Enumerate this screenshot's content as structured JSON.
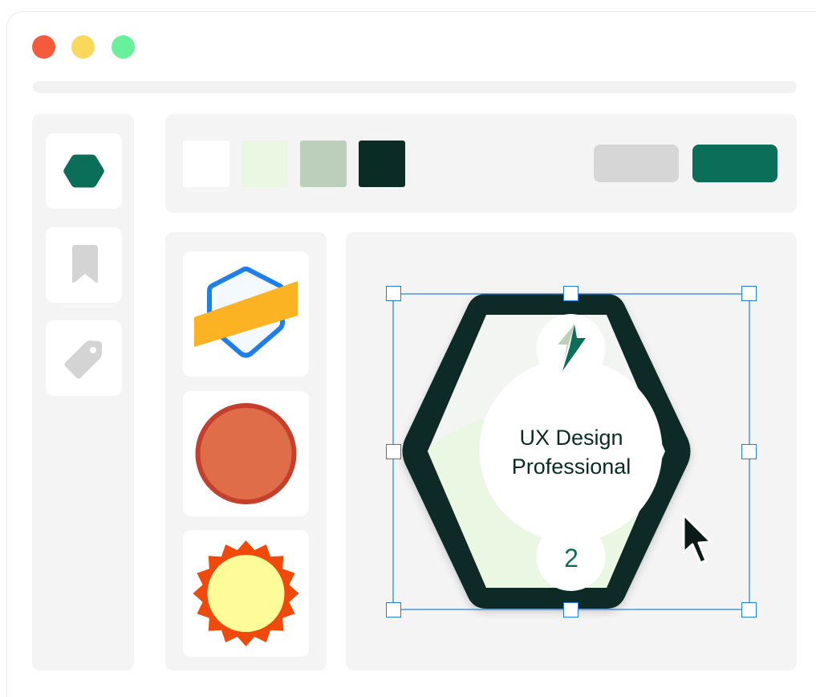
{
  "window_controls": [
    {
      "name": "close",
      "color": "#f45a3b"
    },
    {
      "name": "minimize",
      "color": "#f9d85c"
    },
    {
      "name": "maximize",
      "color": "#68f09a"
    }
  ],
  "sidebar": {
    "items": [
      {
        "icon": "hexagon-icon",
        "active": true,
        "color": "#0b6e58"
      },
      {
        "icon": "bookmark-icon",
        "active": false,
        "color": "#d4d4d4"
      },
      {
        "icon": "tag-icon",
        "active": false,
        "color": "#d4d4d4"
      }
    ]
  },
  "toolbar": {
    "swatches": [
      "#ffffff",
      "#e9f7e3",
      "#bccfba",
      "#0b2c25"
    ],
    "secondary_button": {
      "label": "",
      "color": "#d6d6d6"
    },
    "primary_button": {
      "label": "",
      "color": "#0b6e58"
    }
  },
  "shape_library": [
    {
      "icon": "shield-ribbon-badge-icon",
      "colors": {
        "outline": "#1f7fe8",
        "fill": "#f3f9ff",
        "ribbon": "#fbb324"
      }
    },
    {
      "icon": "circle-badge-icon",
      "colors": {
        "outline": "#c4402c",
        "fill": "#e06d4a"
      }
    },
    {
      "icon": "sunburst-badge-icon",
      "colors": {
        "outline": "#ef4a0c",
        "fill": "#fdfc98"
      }
    }
  ],
  "canvas": {
    "badge": {
      "title_line1": "UX Design",
      "title_line2": "Professional",
      "level": "2",
      "top_icon": "lightning-bolt-icon",
      "colors": {
        "frame": "#0b2c25",
        "inner": "#f3f5f2",
        "wave": "#e9f7e3",
        "text": "#0b2c25",
        "level_text": "#0b6e58"
      }
    },
    "selection_color": "#1f7fd8"
  }
}
